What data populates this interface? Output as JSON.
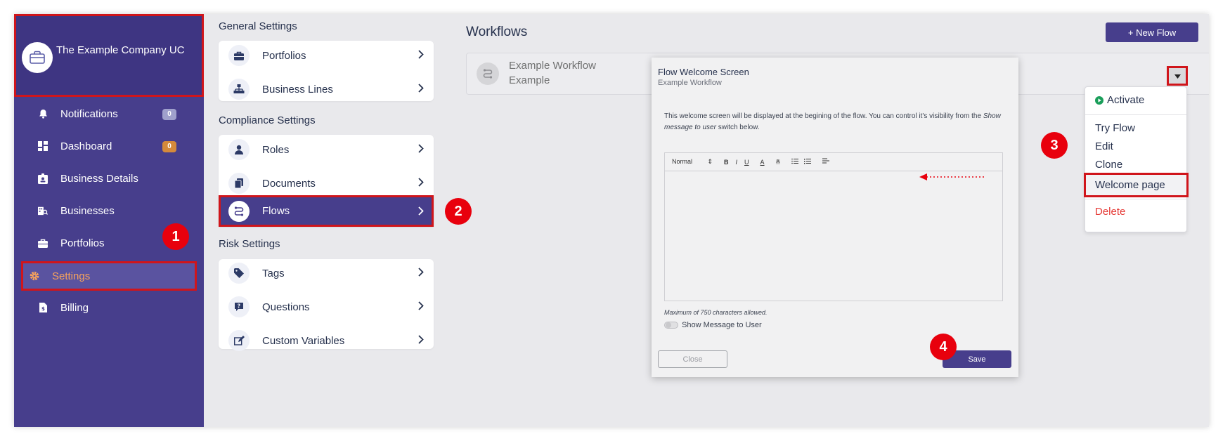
{
  "sidebar": {
    "company_name": "The Example Company UC",
    "items": [
      {
        "label": "Notifications",
        "badge": "0",
        "badge_color": "#9fa0cc"
      },
      {
        "label": "Dashboard",
        "badge": "0",
        "badge_color": "#d58a3b"
      },
      {
        "label": "Business Details"
      },
      {
        "label": "Businesses"
      },
      {
        "label": "Portfolios"
      },
      {
        "label": "Settings"
      },
      {
        "label": "Billing"
      }
    ]
  },
  "settings": {
    "general_title": "General Settings",
    "general_items": [
      "Portfolios",
      "Business Lines"
    ],
    "compliance_title": "Compliance Settings",
    "compliance_items": [
      "Roles",
      "Documents",
      "Flows"
    ],
    "risk_title": "Risk Settings",
    "risk_items": [
      "Tags",
      "Questions",
      "Custom Variables"
    ]
  },
  "workflows": {
    "title": "Workflows",
    "new_flow_label": "+ New Flow",
    "item_name": "Example Workflow",
    "item_sub": "Example"
  },
  "menu": {
    "activate": "Activate",
    "try_flow": "Try Flow",
    "edit": "Edit",
    "clone": "Clone",
    "welcome_page": "Welcome page",
    "delete": "Delete"
  },
  "modal": {
    "title": "Flow Welcome Screen",
    "subtitle": "Example Workflow",
    "body_1": "This welcome screen will be displayed at the begining of the flow. You can control it's visibility from the ",
    "body_em": "Show message to user",
    "body_2": " switch below.",
    "format_select": "Normal",
    "bold": "B",
    "italic": "I",
    "underline": "U",
    "font_color": "A",
    "highlight": "A",
    "hint": "Maximum of 750 characters allowed.",
    "switch_label": "Show Message to User",
    "close_label": "Close",
    "save_label": "Save"
  },
  "callouts": [
    "1",
    "2",
    "3",
    "4"
  ],
  "colors": {
    "accent": "#473e8c",
    "callout": "#e8000d",
    "highlight_border": "#d0151b",
    "danger": "#e53935",
    "activate": "#1a9e5a"
  }
}
